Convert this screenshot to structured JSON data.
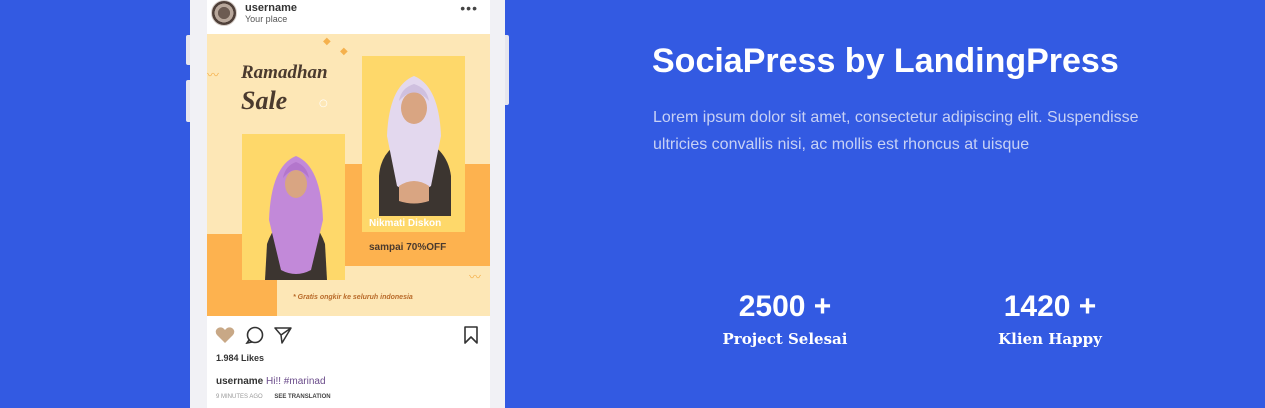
{
  "post": {
    "username": "username",
    "location": "Your place",
    "menu_icon": "more-dots-icon",
    "image_text": {
      "title_line1": "Ramadhan",
      "title_line2": "Sale",
      "promo_line1": "Nikmati Diskon",
      "promo_line2": "sampai 70%OFF",
      "shipping_note": "* Gratis ongkir ke seluruh indonesia"
    },
    "actions": [
      "heart-icon",
      "comment-icon",
      "share-icon",
      "bookmark-icon"
    ],
    "likes": "1.984 Likes",
    "caption_user": "username",
    "caption_text": "Hi!! #marinad",
    "time_ago": "9 MINUTES AGO",
    "see_translation": "SEE TRANSLATION"
  },
  "hero": {
    "title": "SociaPress by LandingPress",
    "description": "Lorem ipsum dolor sit amet, consectetur adipiscing elit. Suspendisse ultricies convallis nisi, ac mollis est rhoncus at uisque"
  },
  "stats": [
    {
      "value": "2500 +",
      "label": "Project Selesai"
    },
    {
      "value": "1420 +",
      "label": "Klien Happy"
    }
  ],
  "colors": {
    "background": "#335ae2",
    "accent_yellow": "#fed86a",
    "accent_orange": "#fdb24f"
  }
}
